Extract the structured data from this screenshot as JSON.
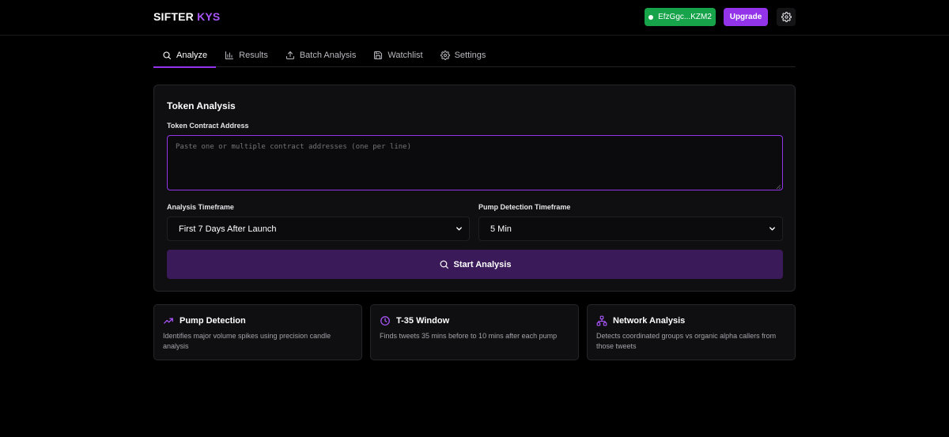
{
  "app": {
    "logo_primary": "SIFTER",
    "logo_accent": "KYS"
  },
  "header": {
    "wallet_label": "EfzGgc...KZM2",
    "upgrade_label": "Upgrade",
    "settings_icon": "gear-icon"
  },
  "tabs": [
    {
      "label": "Analyze",
      "icon": "search-icon",
      "active": true
    },
    {
      "label": "Results",
      "icon": "bar-chart-icon",
      "active": false
    },
    {
      "label": "Batch Analysis",
      "icon": "upload-icon",
      "active": false
    },
    {
      "label": "Watchlist",
      "icon": "save-icon",
      "active": false
    },
    {
      "label": "Settings",
      "icon": "gear-icon",
      "active": false
    }
  ],
  "analysis": {
    "title": "Token Analysis",
    "address_label": "Token Contract Address",
    "address_placeholder": "Paste one or multiple contract addresses (one per line)",
    "address_value": "",
    "timeframe_label": "Analysis Timeframe",
    "timeframe_value": "First 7 Days After Launch",
    "pump_label": "Pump Detection Timeframe",
    "pump_value": "5 Min",
    "start_label": "Start Analysis"
  },
  "features": [
    {
      "title": "Pump Detection",
      "icon": "trending-up-icon",
      "description": "Identifies major volume spikes using precision candle analysis"
    },
    {
      "title": "T-35 Window",
      "icon": "clock-icon",
      "description": "Finds tweets 35 mins before to 10 mins after each pump"
    },
    {
      "title": "Network Analysis",
      "icon": "network-icon",
      "description": "Detects coordinated groups vs organic alpha callers from those tweets"
    }
  ],
  "colors": {
    "accent": "#9333ea",
    "accent_light": "#a855f7",
    "wallet_green": "#16a34a",
    "start_button": "#3b1a5a",
    "background": "#000000",
    "panel": "#0f0f11"
  }
}
